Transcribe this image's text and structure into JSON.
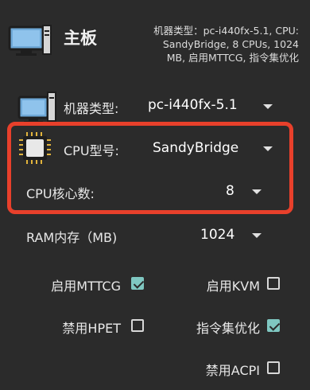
{
  "header": {
    "title": "主板",
    "summary_line1": "机器类型：pc-i440fx-5.1, CPU:",
    "summary_line2": "SandyBridge, 8 CPUs, 1024",
    "summary_line3": "MB, 启用MTTCG, 指令集优化"
  },
  "machine": {
    "label": "机器类型:",
    "value": "pc-i440fx-5.1"
  },
  "cpu_model": {
    "label": "CPU型号:",
    "value": "SandyBridge"
  },
  "cpu_cores": {
    "label": "CPU核心数:",
    "value": "8"
  },
  "ram": {
    "label": "RAM内存（MB)",
    "value": "1024"
  },
  "options": {
    "mttcg": {
      "label": "启用MTTCG",
      "checked": true
    },
    "kvm": {
      "label": "启用KVM",
      "checked": false
    },
    "hpet": {
      "label": "禁用HPET",
      "checked": false
    },
    "iset": {
      "label": "指令集优化",
      "checked": true
    },
    "acpi": {
      "label": "禁用ACPI",
      "checked": false
    }
  },
  "colors": {
    "background": "#2b2b2b",
    "highlight": "#e8402b",
    "checkbox_checked": "#7fc7c1"
  },
  "icons": [
    "computer-icon",
    "chip-icon",
    "dropdown-arrow-icon"
  ]
}
